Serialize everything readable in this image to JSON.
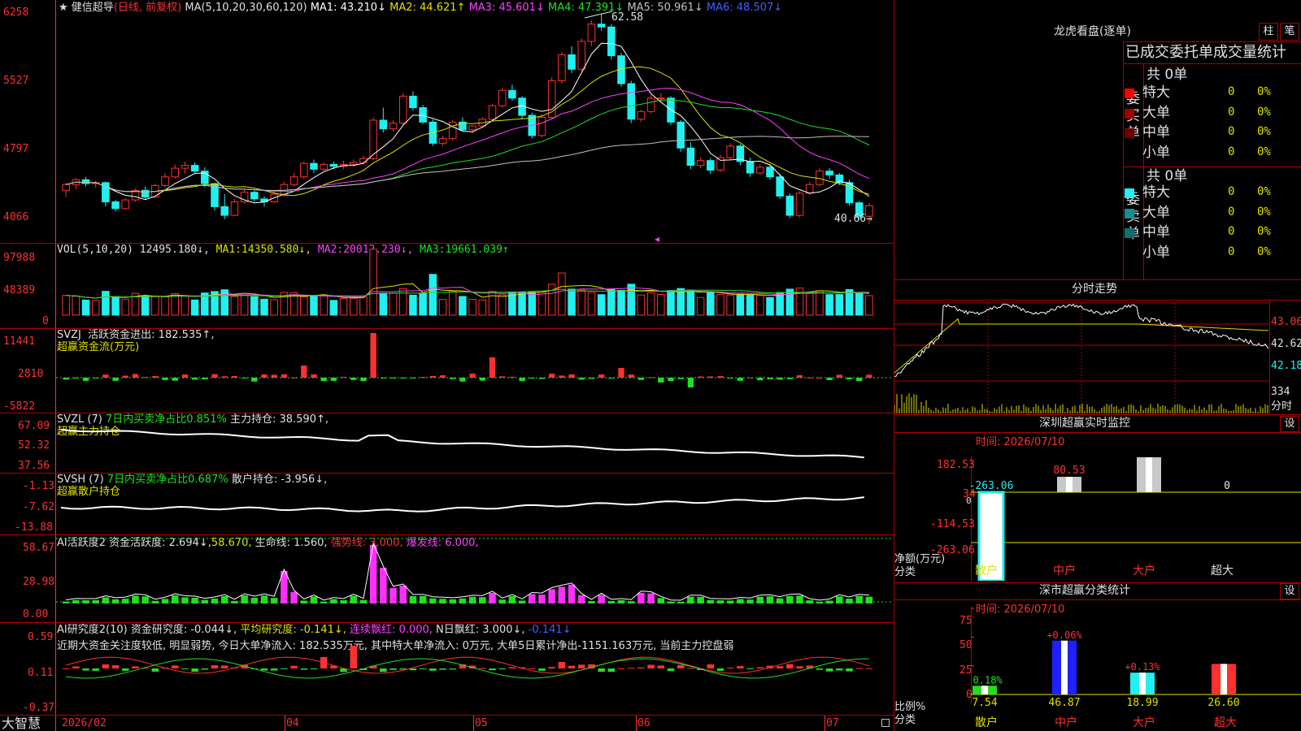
{
  "colors": {
    "up": "#ff3030",
    "down": "#20f0f0",
    "ma1": "#ffffff",
    "ma2": "#e0e000",
    "ma3": "#ff40ff",
    "ma4": "#20e020",
    "ma5": "#c0c0c0",
    "ma6": "#4060ff",
    "grid": "#b00000",
    "axis": "#ff3030"
  },
  "price_panel": {
    "stock_name": "健信超导",
    "mode": "(日线, 前复权)",
    "ma_label": "MA(5,10,20,30,60,120)",
    "ma": [
      {
        "name": "MA1:",
        "value": "43.210↓"
      },
      {
        "name": "MA2:",
        "value": "44.621↑"
      },
      {
        "name": "MA3:",
        "value": "45.601↓"
      },
      {
        "name": "MA4:",
        "value": "47.391↓"
      },
      {
        "name": "MA5:",
        "value": "50.961↓"
      },
      {
        "name": "MA6:",
        "value": "48.507↓"
      }
    ],
    "y_ticks": [
      "6258",
      "5527",
      "4797",
      "4066"
    ],
    "high_label": "62.58",
    "low_label": "40.66→"
  },
  "vol_panel": {
    "label": "VOL(5,10,20)",
    "value": "12495.180↓,",
    "ma": [
      {
        "name": "MA1:",
        "value": "14350.580↓,"
      },
      {
        "name": "MA2:",
        "value": "20012.230↓,"
      },
      {
        "name": "MA3:",
        "value": "19661.039↑"
      }
    ],
    "y_ticks": [
      "97988",
      "48389",
      "0"
    ]
  },
  "svzj_panel": {
    "label": "SVZJ",
    "line1": "活跃资金进出: 182.535↑,",
    "line2": "超赢资金流(万元)",
    "y_ticks": [
      "11441",
      "2810",
      "-5822"
    ]
  },
  "svzl_panel": {
    "label": "SVZL (7)",
    "ratio": "7日内买卖净占比0.851%",
    "hold": "主力持仓: 38.590↑,",
    "line2": "超赢主力持仓",
    "y_ticks": [
      "67.09",
      "52.32",
      "37.56"
    ]
  },
  "svsh_panel": {
    "label": "SVSH (7)",
    "ratio": "7日内买卖净占比0.687%",
    "hold": "散户持仓: -3.956↓,",
    "line2": "超赢散户持仓",
    "y_ticks": [
      "-1.13",
      "-7.62",
      "-13.88"
    ]
  },
  "ai_active_panel": {
    "label": "AI活跃度2",
    "v1": "资金活跃度: 2.694↓,",
    "v2": "58.670,",
    "v3": "生命线: 1.560,",
    "v4": "强势线: 3.000,",
    "v5": "爆发线: 6.000,",
    "y_ticks": [
      "58.67",
      "28.98",
      "0.00"
    ]
  },
  "ai_research_panel": {
    "label": "AI研究度2(10)",
    "v1": "资金研究度: -0.044↓,",
    "v2": "平均研究度: -0.141↓,",
    "v3": "连续飘红: 0.000,",
    "v4": "N日飘红: 3.000↓,",
    "v5": "-0.141↓",
    "summary": "近期大资金关注度较低, 明显弱势, 今日大单净流入: 182.535万元, 其中特大单净流入: 0万元, 大单5日累计净出-1151.163万元, 当前主力控盘弱",
    "y_ticks": [
      "0.59",
      "0.11",
      "-0.37"
    ]
  },
  "bottom_bar": {
    "brand": "大智慧",
    "months": [
      {
        "label": "2026/02"
      },
      {
        "label": "04"
      },
      {
        "label": "05"
      },
      {
        "label": "06"
      },
      {
        "label": "07"
      }
    ]
  },
  "longhu": {
    "title": "龙虎看盘(逐单)",
    "btn_bar": "柱",
    "btn_pen": "笔",
    "subtitle": "已成交委托单成交量统计",
    "buy_side": "委买单",
    "sell_side": "委卖单",
    "buy_total": "共 0单",
    "sell_total": "共 0单",
    "buy_rows": [
      {
        "label": "特大",
        "count": "0",
        "pct": "0%",
        "color": "#ff0000"
      },
      {
        "label": "大单",
        "count": "0",
        "pct": "0%",
        "color": "#a00000"
      },
      {
        "label": "中单",
        "count": "0",
        "pct": "0%",
        "color": "#700000"
      },
      {
        "label": "小单",
        "count": "0",
        "pct": "0%",
        "color": "#000000"
      }
    ],
    "sell_rows": [
      {
        "label": "特大",
        "count": "0",
        "pct": "0%",
        "color": "#20f0f0"
      },
      {
        "label": "大单",
        "count": "0",
        "pct": "0%",
        "color": "#109090"
      },
      {
        "label": "中单",
        "count": "0",
        "pct": "0%",
        "color": "#107070"
      },
      {
        "label": "小单",
        "count": "0",
        "pct": "0%",
        "color": "#000000"
      }
    ]
  },
  "intraday": {
    "title": "分时走势",
    "right_ticks": [
      "43.06",
      "42.62",
      "42.18"
    ],
    "vol_label": "334",
    "vol_unit": "分时"
  },
  "sz_monitor": {
    "title": "深圳超赢实时监控",
    "settings": "设",
    "time": "时间: 2026/07/10",
    "y_ticks": [
      "182.53",
      "34",
      "0",
      "-114.53",
      "-263.06"
    ],
    "unit_label": "净额(万元)",
    "category_label": "分类",
    "chart_data": {
      "type": "bar",
      "categories": [
        "散户",
        "中户",
        "大户",
        "超大"
      ],
      "values": [
        -263.06,
        80.53,
        182.53,
        0
      ],
      "value_labels": [
        "-263.06",
        "80.53",
        "182.53",
        "0"
      ],
      "ylim": [
        -263.06,
        182.53
      ]
    }
  },
  "sz_stats": {
    "title": "深市超赢分类统计",
    "settings": "设",
    "time": "时间: 2026/07/10",
    "y_ticks": [
      "75",
      "50",
      "25",
      "0"
    ],
    "unit_label": "比例%",
    "category_label": "分类",
    "chart_data": {
      "type": "bar",
      "categories": [
        "散户",
        "中户",
        "大户",
        "超大"
      ],
      "values": [
        7.54,
        46.87,
        18.99,
        26.6
      ],
      "changes": [
        "-0.18%",
        "+0.06%",
        "+0.13%",
        ""
      ],
      "ylim": [
        0,
        75
      ]
    }
  },
  "price_chart_data": {
    "type": "candlestick",
    "ylim": [
      40,
      63.5
    ],
    "candles": [
      [
        44.2,
        45.0,
        43.5,
        44.8
      ],
      [
        44.8,
        45.5,
        44.3,
        45.3
      ],
      [
        45.3,
        45.6,
        44.6,
        44.9
      ],
      [
        44.9,
        45.2,
        44.5,
        45.0
      ],
      [
        45.0,
        45.1,
        42.5,
        43.0
      ],
      [
        43.0,
        43.2,
        42.0,
        42.3
      ],
      [
        42.3,
        43.4,
        42.2,
        43.2
      ],
      [
        43.2,
        44.4,
        43.0,
        44.2
      ],
      [
        44.2,
        44.6,
        43.3,
        43.5
      ],
      [
        43.5,
        44.9,
        43.4,
        44.7
      ],
      [
        44.7,
        46.0,
        44.5,
        45.6
      ],
      [
        45.6,
        46.9,
        45.4,
        46.5
      ],
      [
        46.5,
        47.2,
        46.0,
        46.8
      ],
      [
        46.8,
        47.1,
        46.0,
        46.2
      ],
      [
        46.2,
        46.6,
        44.5,
        44.9
      ],
      [
        44.9,
        45.0,
        42.1,
        42.5
      ],
      [
        42.5,
        43.8,
        41.2,
        41.6
      ],
      [
        41.6,
        43.3,
        41.5,
        43.0
      ],
      [
        43.0,
        44.3,
        42.8,
        44.0
      ],
      [
        44.0,
        44.2,
        43.0,
        43.3
      ],
      [
        43.3,
        43.6,
        42.5,
        43.0
      ],
      [
        43.0,
        44.1,
        42.9,
        43.8
      ],
      [
        43.8,
        45.1,
        43.6,
        44.8
      ],
      [
        44.8,
        46.0,
        44.6,
        45.6
      ],
      [
        45.6,
        47.2,
        45.4,
        47.0
      ],
      [
        47.0,
        47.4,
        46.0,
        46.4
      ],
      [
        46.4,
        47.1,
        46.2,
        46.9
      ],
      [
        46.9,
        47.2,
        46.4,
        46.7
      ],
      [
        46.7,
        47.3,
        46.4,
        46.9
      ],
      [
        46.9,
        47.4,
        46.7,
        47.1
      ],
      [
        47.1,
        47.8,
        46.9,
        47.5
      ],
      [
        47.5,
        51.8,
        47.3,
        51.5
      ],
      [
        51.5,
        52.8,
        50.2,
        50.6
      ],
      [
        50.6,
        51.5,
        50.3,
        51.2
      ],
      [
        51.2,
        54.3,
        51.0,
        54.0
      ],
      [
        54.0,
        54.5,
        52.5,
        52.8
      ],
      [
        52.8,
        53.1,
        51.1,
        51.3
      ],
      [
        51.3,
        51.6,
        48.8,
        49.1
      ],
      [
        49.1,
        49.9,
        48.8,
        49.6
      ],
      [
        49.6,
        51.5,
        49.4,
        51.3
      ],
      [
        51.3,
        51.8,
        50.3,
        50.5
      ],
      [
        50.5,
        51.0,
        50.2,
        50.9
      ],
      [
        50.9,
        51.8,
        50.7,
        51.6
      ],
      [
        51.6,
        53.2,
        51.4,
        53.0
      ],
      [
        53.0,
        54.9,
        52.8,
        54.6
      ],
      [
        54.6,
        55.2,
        53.5,
        53.8
      ],
      [
        53.8,
        54.0,
        51.6,
        52.0
      ],
      [
        52.0,
        52.3,
        49.6,
        49.9
      ],
      [
        49.9,
        52.1,
        49.7,
        51.8
      ],
      [
        51.8,
        56.0,
        51.6,
        55.6
      ],
      [
        55.6,
        58.6,
        55.3,
        58.3
      ],
      [
        58.3,
        59.2,
        56.4,
        56.8
      ],
      [
        56.8,
        60.0,
        56.6,
        59.7
      ],
      [
        59.7,
        61.9,
        59.2,
        61.5
      ],
      [
        61.5,
        62.58,
        60.8,
        61.2
      ],
      [
        61.2,
        61.5,
        57.8,
        58.2
      ],
      [
        58.2,
        58.5,
        55.0,
        55.3
      ],
      [
        55.3,
        55.6,
        51.2,
        51.6
      ],
      [
        51.6,
        52.6,
        51.3,
        52.4
      ],
      [
        52.4,
        54.1,
        52.2,
        53.8
      ],
      [
        53.8,
        54.3,
        53.3,
        53.8
      ],
      [
        53.8,
        54.0,
        51.0,
        51.3
      ],
      [
        51.3,
        51.5,
        48.2,
        48.6
      ],
      [
        48.6,
        49.2,
        46.4,
        46.8
      ],
      [
        46.8,
        47.6,
        46.5,
        47.3
      ],
      [
        47.3,
        47.6,
        45.9,
        46.3
      ],
      [
        46.3,
        47.9,
        46.1,
        47.6
      ],
      [
        47.6,
        49.1,
        47.4,
        48.8
      ],
      [
        48.8,
        49.0,
        46.8,
        47.2
      ],
      [
        47.2,
        47.6,
        45.6,
        46.0
      ],
      [
        46.0,
        46.9,
        45.8,
        46.6
      ],
      [
        46.6,
        46.9,
        45.3,
        45.6
      ],
      [
        45.6,
        45.9,
        43.3,
        43.6
      ],
      [
        43.6,
        43.9,
        41.3,
        41.6
      ],
      [
        41.6,
        44.1,
        41.4,
        43.9
      ],
      [
        43.9,
        45.1,
        43.7,
        44.8
      ],
      [
        44.8,
        46.5,
        44.6,
        46.2
      ],
      [
        46.2,
        46.5,
        45.4,
        45.8
      ],
      [
        45.8,
        46.0,
        44.7,
        45.0
      ],
      [
        45.0,
        45.3,
        42.6,
        42.9
      ],
      [
        42.9,
        43.1,
        41.2,
        41.5
      ],
      [
        41.5,
        42.9,
        40.66,
        42.6
      ]
    ]
  }
}
